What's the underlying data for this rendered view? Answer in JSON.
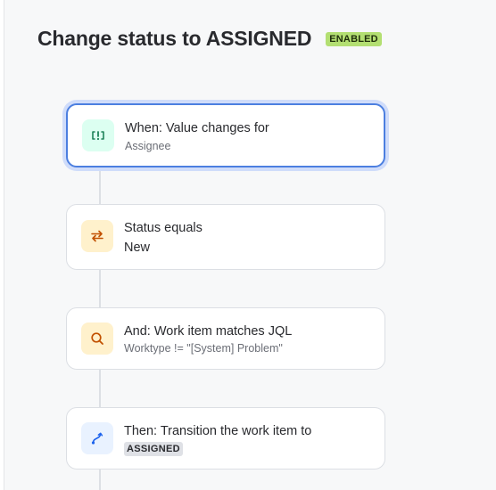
{
  "header": {
    "title": "Change status to ASSIGNED",
    "status_badge": "ENABLED"
  },
  "rule_steps": [
    {
      "title": "When: Value changes for",
      "subtitle": "Assignee",
      "icon": "field-change-icon",
      "icon_color": "#1f845a",
      "icon_bg": "#dcfff1"
    },
    {
      "title": "Status equals",
      "subtitle": "New",
      "icon": "swap-arrows-icon",
      "icon_color": "#c25100",
      "icon_bg": "#fff1cc"
    },
    {
      "title": "And: Work item matches JQL",
      "subtitle": "Worktype != \"[System] Problem\"",
      "icon": "search-icon",
      "icon_color": "#c25100",
      "icon_bg": "#fff1cc"
    },
    {
      "title": "Then: Transition the work item to",
      "subtitle": "ASSIGNED",
      "icon": "transition-icon",
      "icon_color": "#1d63ed",
      "icon_bg": "#e9f2ff"
    }
  ],
  "colors": {
    "selected_border": "#4c7fe0",
    "enabled_badge": "#b3df72"
  }
}
